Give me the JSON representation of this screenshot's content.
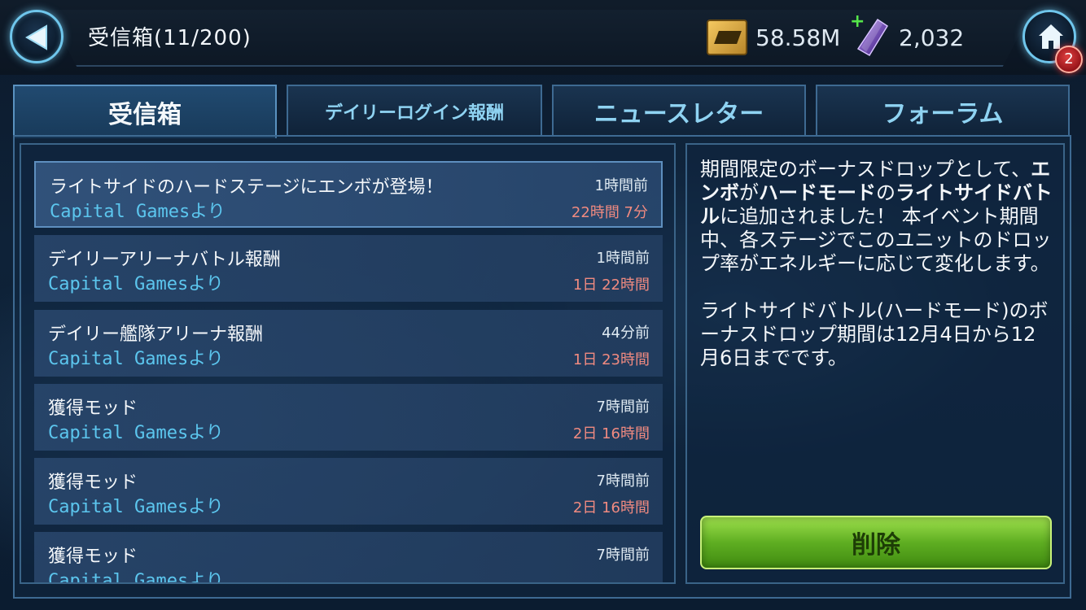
{
  "header": {
    "title": "受信箱(11/200)",
    "credits": "58.58M",
    "crystals": "2,032",
    "notification_count": "2"
  },
  "tabs": [
    {
      "label": "受信箱",
      "active": true
    },
    {
      "label": "デイリーログイン報酬",
      "active": false
    },
    {
      "label": "ニュースレター",
      "active": false
    },
    {
      "label": "フォーラム",
      "active": false
    }
  ],
  "messages": [
    {
      "subject": "ライトサイドのハードステージにエンボが登場！",
      "sender": "Capital Gamesより",
      "received": "1時間前",
      "expiry": "22時間 7分",
      "selected": true
    },
    {
      "subject": "デイリーアリーナバトル報酬",
      "sender": "Capital Gamesより",
      "received": "1時間前",
      "expiry": "1日 22時間",
      "selected": false
    },
    {
      "subject": "デイリー艦隊アリーナ報酬",
      "sender": "Capital Gamesより",
      "received": "44分前",
      "expiry": "1日 23時間",
      "selected": false
    },
    {
      "subject": "獲得モッド",
      "sender": "Capital Gamesより",
      "received": "7時間前",
      "expiry": "2日 16時間",
      "selected": false
    },
    {
      "subject": "獲得モッド",
      "sender": "Capital Gamesより",
      "received": "7時間前",
      "expiry": "2日 16時間",
      "selected": false
    },
    {
      "subject": "獲得モッド",
      "sender": "Capital Gamesより",
      "received": "7時間前",
      "expiry": "",
      "selected": false
    }
  ],
  "detail": {
    "p1_a": "期間限定のボーナスドロップとして、",
    "p1_b": "エンボ",
    "p1_c": "が",
    "p1_d": "ハードモード",
    "p1_e": "の",
    "p1_f": "ライトサイドバトル",
    "p1_g": "に追加されました！ 本イベント期間中、各ステージでこのユニットのドロップ率がエネルギーに応じて変化します。",
    "p2": "ライトサイドバトル(ハードモード)のボーナスドロップ期間は12月4日から12月6日までです。",
    "delete_label": "削除"
  },
  "colors": {
    "accent_cyan": "#6fc6ec",
    "sender_blue": "#5cc6ee",
    "expiry_red": "#f08a80",
    "delete_green": "#5fae22",
    "badge_red": "#e04040"
  },
  "icons": {
    "back": "back-arrow-icon",
    "home": "home-icon",
    "credits": "credits-icon",
    "crystals": "crystal-icon",
    "add": "plus-icon"
  }
}
